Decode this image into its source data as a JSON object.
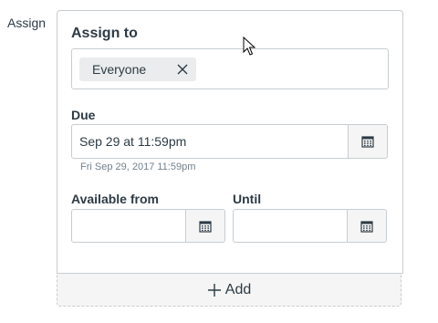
{
  "side_label": "Assign",
  "card": {
    "title": "Assign to",
    "assignee_chip": "Everyone",
    "due": {
      "label": "Due",
      "value": "Sep 29 at 11:59pm",
      "hint": "Fri Sep 29, 2017 11:59pm"
    },
    "available_from": {
      "label": "Available from",
      "value": ""
    },
    "until": {
      "label": "Until",
      "value": ""
    }
  },
  "add_button": {
    "label": "Add",
    "icon": "plus-icon"
  },
  "colors": {
    "text": "#2d3b45",
    "border": "#c7cdd1",
    "hint": "#73818c",
    "button_bg": "#f5f5f5"
  }
}
